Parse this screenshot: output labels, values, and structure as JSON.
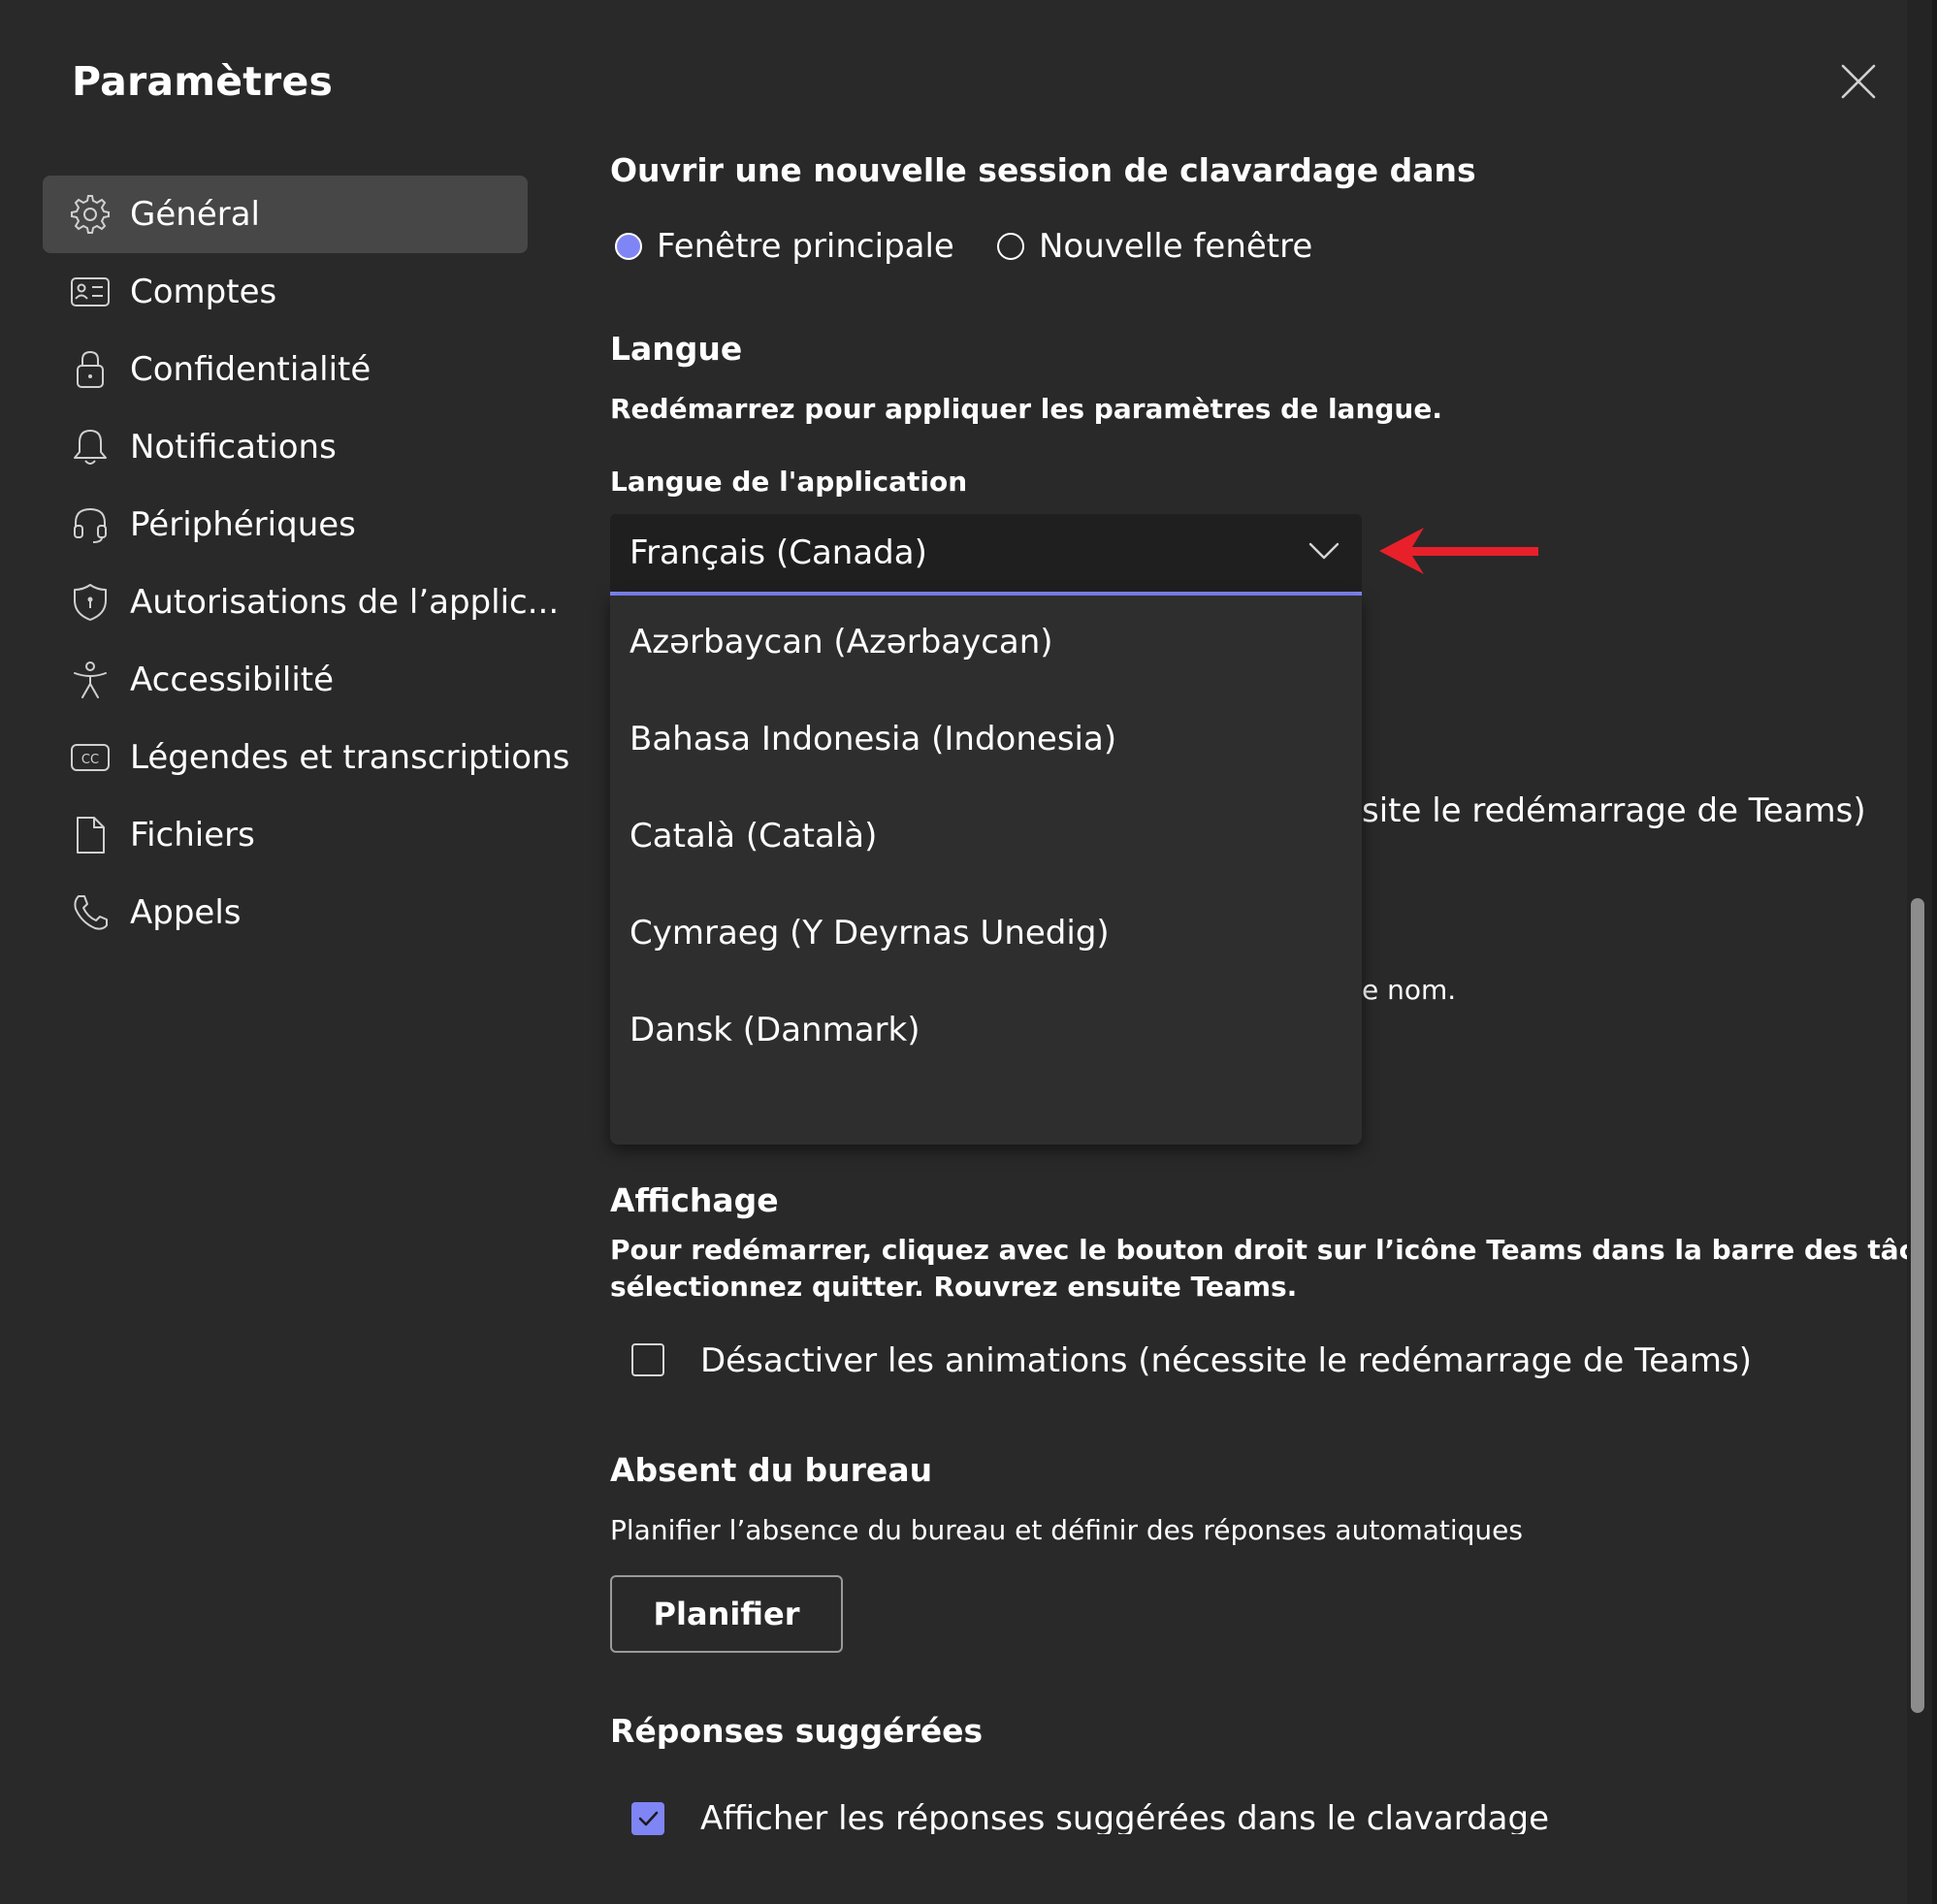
{
  "window": {
    "title": "Paramètres"
  },
  "sidebar": {
    "items": [
      {
        "label": "Général",
        "icon": "gear-icon",
        "active": true
      },
      {
        "label": "Comptes",
        "icon": "id-card-icon"
      },
      {
        "label": "Confidentialité",
        "icon": "lock-icon"
      },
      {
        "label": "Notifications",
        "icon": "bell-icon"
      },
      {
        "label": "Périphériques",
        "icon": "headset-icon"
      },
      {
        "label": "Autorisations de l’applic...",
        "icon": "shield-icon"
      },
      {
        "label": "Accessibilité",
        "icon": "accessibility-icon"
      },
      {
        "label": "Légendes et transcriptions",
        "icon": "cc-icon"
      },
      {
        "label": "Fichiers",
        "icon": "document-icon"
      },
      {
        "label": "Appels",
        "icon": "phone-icon"
      }
    ]
  },
  "chat_session": {
    "title": "Ouvrir une nouvelle session de clavardage dans",
    "options": [
      {
        "label": "Fenêtre principale",
        "selected": true
      },
      {
        "label": "Nouvelle fenêtre",
        "selected": false
      }
    ]
  },
  "language": {
    "title": "Langue",
    "restart_note": "Redémarrez pour appliquer les paramètres de langue.",
    "app_language_label": "Langue de l'application",
    "selected": "Français (Canada)",
    "options": [
      "Azərbaycan (Azərbaycan)",
      "Bahasa Indonesia (Indonesia)",
      "Català (Català)",
      "Cymraeg (Y Deyrnas Unedig)",
      "Dansk (Danmark)"
    ],
    "partial_text_right_1": "site le redémarrage de Teams)",
    "partial_text_right_2": "e nom."
  },
  "display": {
    "title": "Affichage",
    "note_line1": "Pour redémarrer, cliquez avec le bouton droit sur l’icône Teams dans la barre des tâches, puis",
    "note_line2": "sélectionnez quitter. Rouvrez ensuite Teams.",
    "disable_animations_label": "Désactiver les animations (nécessite le redémarrage de Teams)",
    "disable_animations_checked": false
  },
  "out_of_office": {
    "title": "Absent du bureau",
    "description": "Planifier l’absence du bureau et définir des réponses automatiques",
    "button_label": "Planifier"
  },
  "suggested_replies": {
    "title": "Réponses suggérées",
    "show_label": "Afficher les réponses suggérées dans le clavardage",
    "checked": true
  },
  "colors": {
    "background": "#292929",
    "accent": "#7f85f5",
    "annotation_arrow": "#e8202a",
    "active_nav": "#474747"
  }
}
